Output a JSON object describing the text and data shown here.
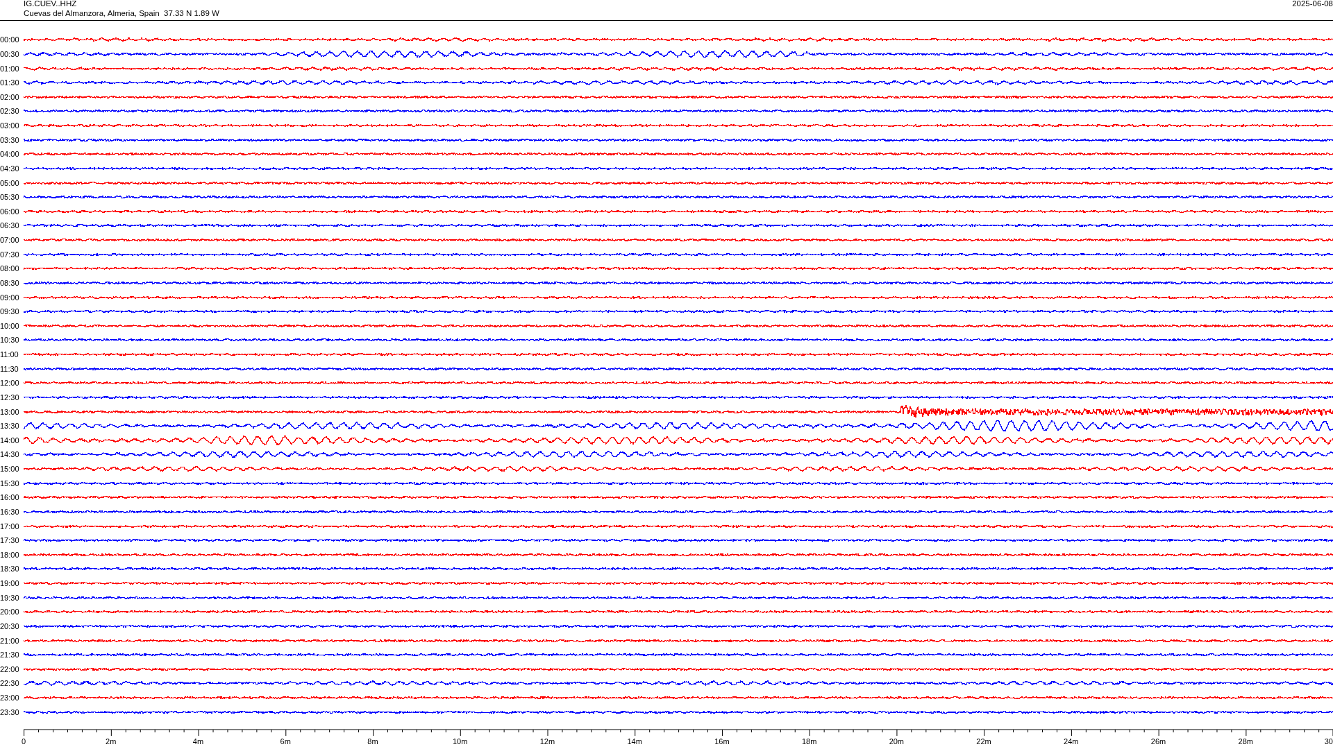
{
  "header": {
    "title": "IG.CUEV..HHZ",
    "subtitle": "Cuevas del Almanzora, Almeria, Spain  37.33 N 1.89 W",
    "date": "2025-06-08"
  },
  "traces": [
    {
      "label": "00:00",
      "color": "#ff0000"
    },
    {
      "label": "00:30",
      "color": "#0000ff"
    },
    {
      "label": "01:00",
      "color": "#ff0000"
    },
    {
      "label": "01:30",
      "color": "#0000ff"
    },
    {
      "label": "02:00",
      "color": "#ff0000"
    },
    {
      "label": "02:30",
      "color": "#0000ff"
    },
    {
      "label": "03:00",
      "color": "#ff0000"
    },
    {
      "label": "03:30",
      "color": "#0000ff"
    },
    {
      "label": "04:00",
      "color": "#ff0000"
    },
    {
      "label": "04:30",
      "color": "#0000ff"
    },
    {
      "label": "05:00",
      "color": "#ff0000"
    },
    {
      "label": "05:30",
      "color": "#0000ff"
    },
    {
      "label": "06:00",
      "color": "#ff0000"
    },
    {
      "label": "06:30",
      "color": "#0000ff"
    },
    {
      "label": "07:00",
      "color": "#ff0000"
    },
    {
      "label": "07:30",
      "color": "#0000ff"
    },
    {
      "label": "08:00",
      "color": "#ff0000"
    },
    {
      "label": "08:30",
      "color": "#0000ff"
    },
    {
      "label": "09:00",
      "color": "#ff0000"
    },
    {
      "label": "09:30",
      "color": "#0000ff"
    },
    {
      "label": "10:00",
      "color": "#ff0000"
    },
    {
      "label": "10:30",
      "color": "#0000ff"
    },
    {
      "label": "11:00",
      "color": "#ff0000"
    },
    {
      "label": "11:30",
      "color": "#0000ff"
    },
    {
      "label": "12:00",
      "color": "#ff0000"
    },
    {
      "label": "12:30",
      "color": "#0000ff"
    },
    {
      "label": "13:00",
      "color": "#ff0000"
    },
    {
      "label": "13:30",
      "color": "#0000ff"
    },
    {
      "label": "14:00",
      "color": "#ff0000"
    },
    {
      "label": "14:30",
      "color": "#0000ff"
    },
    {
      "label": "15:00",
      "color": "#ff0000"
    },
    {
      "label": "15:30",
      "color": "#0000ff"
    },
    {
      "label": "16:00",
      "color": "#ff0000"
    },
    {
      "label": "16:30",
      "color": "#0000ff"
    },
    {
      "label": "17:00",
      "color": "#ff0000"
    },
    {
      "label": "17:30",
      "color": "#0000ff"
    },
    {
      "label": "18:00",
      "color": "#ff0000"
    },
    {
      "label": "18:30",
      "color": "#0000ff"
    },
    {
      "label": "19:00",
      "color": "#ff0000"
    },
    {
      "label": "19:30",
      "color": "#0000ff"
    },
    {
      "label": "20:00",
      "color": "#ff0000"
    },
    {
      "label": "20:30",
      "color": "#0000ff"
    },
    {
      "label": "21:00",
      "color": "#ff0000"
    },
    {
      "label": "21:30",
      "color": "#0000ff"
    },
    {
      "label": "22:00",
      "color": "#ff0000"
    },
    {
      "label": "22:30",
      "color": "#0000ff"
    },
    {
      "label": "23:00",
      "color": "#ff0000"
    },
    {
      "label": "23:30",
      "color": "#0000ff"
    }
  ],
  "x_axis": {
    "labels": [
      "0",
      "2m",
      "4m",
      "6m",
      "8m",
      "10m",
      "12m",
      "14m",
      "16m",
      "18m",
      "20m",
      "22m",
      "24m",
      "26m",
      "28m",
      "30"
    ]
  }
}
